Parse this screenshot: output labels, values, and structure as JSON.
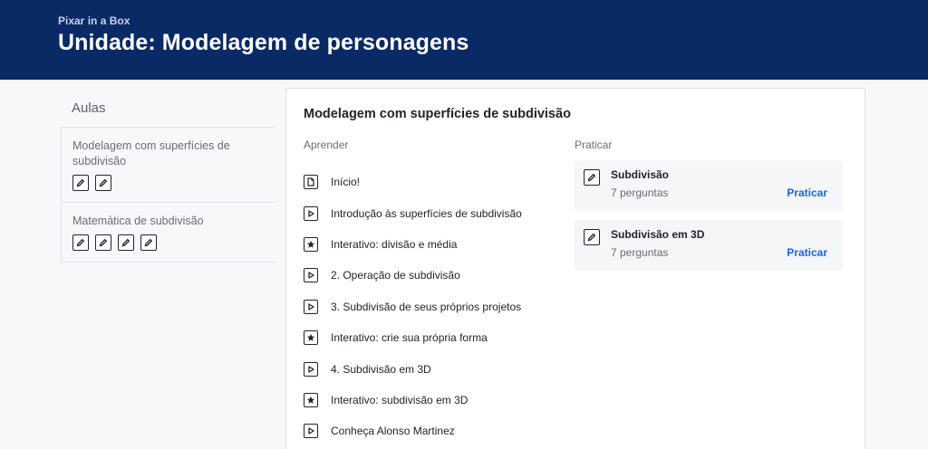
{
  "header": {
    "breadcrumb": "Pixar in a Box",
    "title": "Unidade: Modelagem de personagens",
    "bg_color": "#0a2a66"
  },
  "sidebar": {
    "heading": "Aulas",
    "lessons": [
      {
        "title": "Modelagem com superfícies de subdivisão",
        "chips": [
          "pencil-icon",
          "pencil-icon"
        ]
      },
      {
        "title": "Matemática de subdivisão",
        "chips": [
          "pencil-icon",
          "pencil-icon",
          "pencil-icon",
          "pencil-icon"
        ]
      }
    ]
  },
  "main": {
    "title": "Modelagem com superfícies de subdivisão",
    "learn_heading": "Aprender",
    "practice_heading": "Praticar",
    "learn_items": [
      {
        "label": "Início!",
        "icon": "article-icon"
      },
      {
        "label": "Introdução às superfícies de subdivisão",
        "icon": "play-icon"
      },
      {
        "label": "Interativo: divisão e média",
        "icon": "star-icon"
      },
      {
        "label": "2. Operação de subdivisão",
        "icon": "play-icon"
      },
      {
        "label": "3. Subdivisão de seus próprios projetos",
        "icon": "play-icon"
      },
      {
        "label": "Interativo: crie sua própria forma",
        "icon": "star-icon"
      },
      {
        "label": "4. Subdivisão em 3D",
        "icon": "play-icon"
      },
      {
        "label": "Interativo: subdivisão em 3D",
        "icon": "star-icon"
      },
      {
        "label": "Conheça Alonso Martinez",
        "icon": "play-icon"
      }
    ],
    "practice_items": [
      {
        "title": "Subdivisão",
        "count": "7 perguntas",
        "action": "Praticar"
      },
      {
        "title": "Subdivisão em 3D",
        "count": "7 perguntas",
        "action": "Praticar"
      }
    ],
    "link_color": "#1865f2"
  }
}
